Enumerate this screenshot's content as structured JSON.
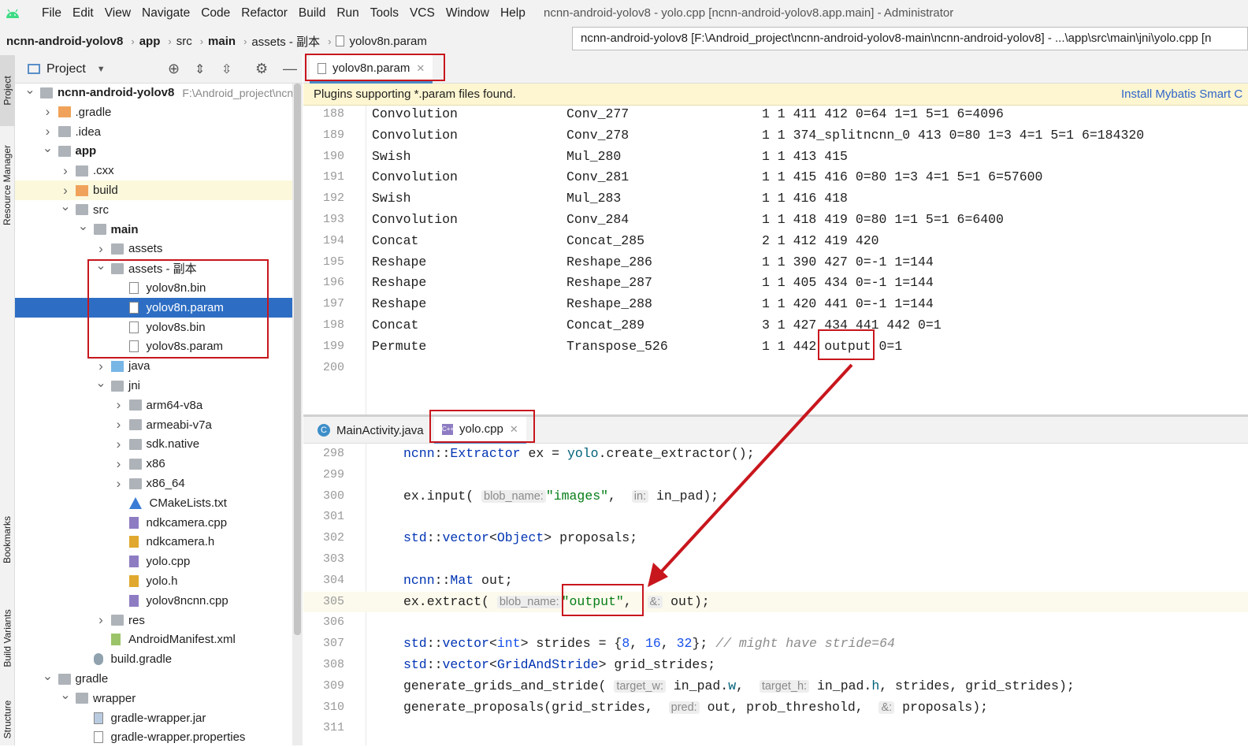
{
  "menubar": {
    "items": [
      "File",
      "Edit",
      "View",
      "Navigate",
      "Code",
      "Refactor",
      "Build",
      "Run",
      "Tools",
      "VCS",
      "Window",
      "Help"
    ],
    "window_title": "ncnn-android-yolov8 - yolo.cpp [ncnn-android-yolov8.app.main] - Administrator"
  },
  "breadcrumb": {
    "items": [
      "ncnn-android-yolov8",
      "app",
      "src",
      "main",
      "assets - 副本",
      "yolov8n.param"
    ],
    "path_tooltip": "ncnn-android-yolov8 [F:\\Android_project\\ncnn-android-yolov8-main\\ncnn-android-yolov8] - ...\\app\\src\\main\\jni\\yolo.cpp [n"
  },
  "side_tabs": {
    "project": "Project",
    "resource_manager": "Resource Manager",
    "bookmarks": "Bookmarks",
    "build_variants": "Build Variants",
    "structure": "Structure"
  },
  "project_panel": {
    "title": "Project",
    "tree": [
      {
        "label": "ncnn-android-yolov8",
        "hint": "F:\\Android_project\\ncnn",
        "depth": 0,
        "arrow": "open",
        "icon": "folder",
        "bold": true
      },
      {
        "label": ".gradle",
        "depth": 1,
        "arrow": "closed",
        "icon": "folder-orange"
      },
      {
        "label": ".idea",
        "depth": 1,
        "arrow": "closed",
        "icon": "folder"
      },
      {
        "label": "app",
        "depth": 1,
        "arrow": "open",
        "icon": "folder",
        "bold": true
      },
      {
        "label": ".cxx",
        "depth": 2,
        "arrow": "closed",
        "icon": "folder"
      },
      {
        "label": "build",
        "depth": 2,
        "arrow": "closed",
        "icon": "folder-orange",
        "highlight": true
      },
      {
        "label": "src",
        "depth": 2,
        "arrow": "open",
        "icon": "folder"
      },
      {
        "label": "main",
        "depth": 3,
        "arrow": "open",
        "icon": "folder",
        "bold": true
      },
      {
        "label": "assets",
        "depth": 4,
        "arrow": "closed",
        "icon": "folder"
      },
      {
        "label": "assets - 副本",
        "depth": 4,
        "arrow": "open",
        "icon": "folder"
      },
      {
        "label": "yolov8n.bin",
        "depth": 5,
        "arrow": "none",
        "icon": "file"
      },
      {
        "label": "yolov8n.param",
        "depth": 5,
        "arrow": "none",
        "icon": "file",
        "selected": true
      },
      {
        "label": "yolov8s.bin",
        "depth": 5,
        "arrow": "none",
        "icon": "file"
      },
      {
        "label": "yolov8s.param",
        "depth": 5,
        "arrow": "none",
        "icon": "file"
      },
      {
        "label": "java",
        "depth": 4,
        "arrow": "closed",
        "icon": "folder-blue"
      },
      {
        "label": "jni",
        "depth": 4,
        "arrow": "open",
        "icon": "folder"
      },
      {
        "label": "arm64-v8a",
        "depth": 5,
        "arrow": "closed",
        "icon": "folder"
      },
      {
        "label": "armeabi-v7a",
        "depth": 5,
        "arrow": "closed",
        "icon": "folder"
      },
      {
        "label": "sdk.native",
        "depth": 5,
        "arrow": "closed",
        "icon": "folder"
      },
      {
        "label": "x86",
        "depth": 5,
        "arrow": "closed",
        "icon": "folder"
      },
      {
        "label": "x86_64",
        "depth": 5,
        "arrow": "closed",
        "icon": "folder"
      },
      {
        "label": "CMakeLists.txt",
        "depth": 5,
        "arrow": "none",
        "icon": "cmake"
      },
      {
        "label": "ndkcamera.cpp",
        "depth": 5,
        "arrow": "none",
        "icon": "cpp"
      },
      {
        "label": "ndkcamera.h",
        "depth": 5,
        "arrow": "none",
        "icon": "h"
      },
      {
        "label": "yolo.cpp",
        "depth": 5,
        "arrow": "none",
        "icon": "cpp"
      },
      {
        "label": "yolo.h",
        "depth": 5,
        "arrow": "none",
        "icon": "h"
      },
      {
        "label": "yolov8ncnn.cpp",
        "depth": 5,
        "arrow": "none",
        "icon": "cpp"
      },
      {
        "label": "res",
        "depth": 4,
        "arrow": "closed",
        "icon": "folder"
      },
      {
        "label": "AndroidManifest.xml",
        "depth": 4,
        "arrow": "none",
        "icon": "manifest"
      },
      {
        "label": "build.gradle",
        "depth": 3,
        "arrow": "none",
        "icon": "gradle"
      },
      {
        "label": "gradle",
        "depth": 1,
        "arrow": "open",
        "icon": "folder"
      },
      {
        "label": "wrapper",
        "depth": 2,
        "arrow": "open",
        "icon": "folder"
      },
      {
        "label": "gradle-wrapper.jar",
        "depth": 3,
        "arrow": "none",
        "icon": "jar"
      },
      {
        "label": "gradle-wrapper.properties",
        "depth": 3,
        "arrow": "none",
        "icon": "file"
      }
    ]
  },
  "top_editor": {
    "tab": "yolov8n.param",
    "plugin_notice": "Plugins supporting *.param files found.",
    "plugin_link": "Install Mybatis Smart C",
    "lines": [
      {
        "n": "188",
        "a": "Convolution",
        "b": "Conv_277",
        "c": "1 1 411 412 0=64 1=1 5=1 6=4096"
      },
      {
        "n": "189",
        "a": "Convolution",
        "b": "Conv_278",
        "c": "1 1 374_splitncnn_0 413 0=80 1=3 4=1 5=1 6=184320"
      },
      {
        "n": "190",
        "a": "Swish",
        "b": "Mul_280",
        "c": "1 1 413 415"
      },
      {
        "n": "191",
        "a": "Convolution",
        "b": "Conv_281",
        "c": "1 1 415 416 0=80 1=3 4=1 5=1 6=57600"
      },
      {
        "n": "192",
        "a": "Swish",
        "b": "Mul_283",
        "c": "1 1 416 418"
      },
      {
        "n": "193",
        "a": "Convolution",
        "b": "Conv_284",
        "c": "1 1 418 419 0=80 1=1 5=1 6=6400"
      },
      {
        "n": "194",
        "a": "Concat",
        "b": "Concat_285",
        "c": "2 1 412 419 420"
      },
      {
        "n": "195",
        "a": "Reshape",
        "b": "Reshape_286",
        "c": "1 1 390 427 0=-1 1=144"
      },
      {
        "n": "196",
        "a": "Reshape",
        "b": "Reshape_287",
        "c": "1 1 405 434 0=-1 1=144"
      },
      {
        "n": "197",
        "a": "Reshape",
        "b": "Reshape_288",
        "c": "1 1 420 441 0=-1 1=144"
      },
      {
        "n": "198",
        "a": "Concat",
        "b": "Concat_289",
        "c": "3 1 427 434 441 442 0=1"
      },
      {
        "n": "199",
        "a": "Permute",
        "b": "Transpose_526",
        "c": "1 1 442 output 0=1"
      },
      {
        "n": "200",
        "a": "",
        "b": "",
        "c": ""
      }
    ]
  },
  "bottom_editor": {
    "tabs": [
      "MainActivity.java",
      "yolo.cpp"
    ],
    "line_numbers": [
      "298",
      "299",
      "300",
      "301",
      "302",
      "303",
      "304",
      "305",
      "306",
      "307",
      "308",
      "309",
      "310",
      "311"
    ],
    "hints": {
      "blob_name": "blob_name:",
      "in": "in:",
      "amp": "&:",
      "target_w": "target_w:",
      "target_h": "target_h:",
      "pred": "pred:"
    }
  },
  "colors": {
    "annotation_red": "#c8161d",
    "selection": "#2d6ec4",
    "accent_link": "#2f65ca"
  }
}
